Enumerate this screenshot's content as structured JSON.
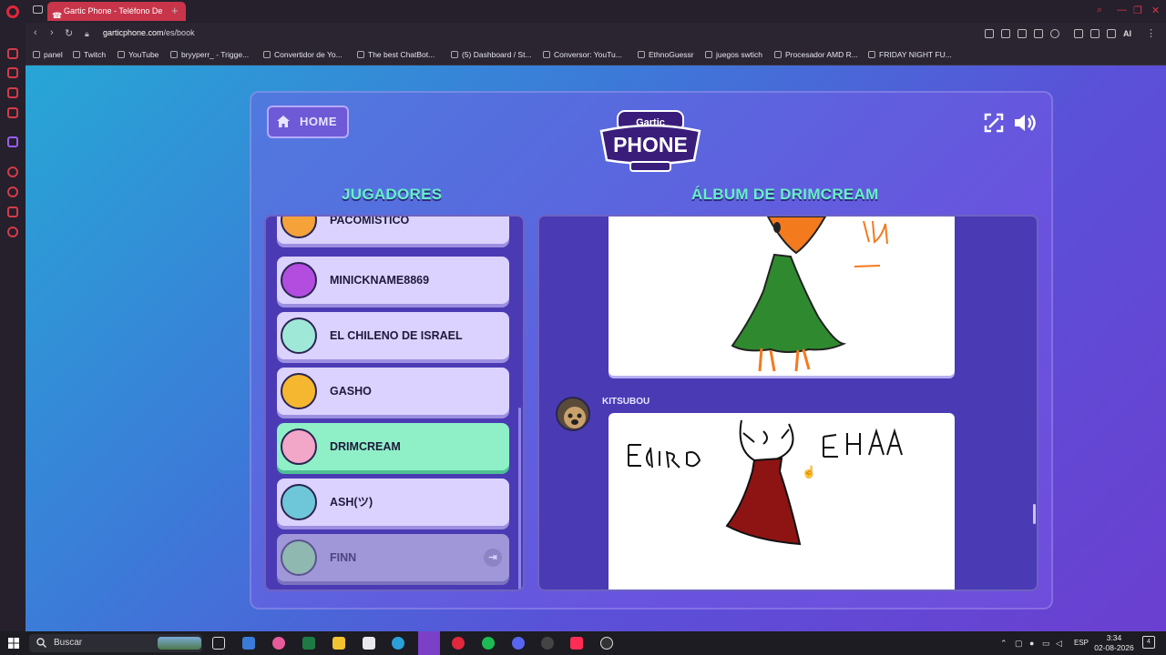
{
  "browser": {
    "tab_title": "Gartic Phone - Teléfono De",
    "new_tab": "+",
    "url_host": "garticphone.com",
    "url_path": "/es/book",
    "ai_label": "AI",
    "bookmarks": [
      {
        "label": "panel"
      },
      {
        "label": "Twitch"
      },
      {
        "label": "YouTube"
      },
      {
        "label": "bryyperr_ - Trigge..."
      },
      {
        "label": "Convertidor de Yo..."
      },
      {
        "label": "The best ChatBot..."
      },
      {
        "label": "(5) Dashboard / St..."
      },
      {
        "label": "Conversor: YouTu..."
      },
      {
        "label": "EthnoGuessr"
      },
      {
        "label": "juegos swtich"
      },
      {
        "label": "Procesador AMD R..."
      },
      {
        "label": "FRIDAY NIGHT FU..."
      }
    ]
  },
  "game": {
    "home_label": "HOME",
    "logo_top": "Gartic",
    "logo_bottom": "PHONE",
    "players_heading": "JUGADORES",
    "album_heading": "ÁLBUM DE DRIMCREAM",
    "players": [
      {
        "name": "PACOMISTICO",
        "state": "normal"
      },
      {
        "name": "MINICKNAME8869",
        "state": "normal"
      },
      {
        "name": "EL CHILENO DE ISRAEL",
        "state": "normal"
      },
      {
        "name": "GASHO",
        "state": "normal"
      },
      {
        "name": "DRIMCREAM",
        "state": "active"
      },
      {
        "name": "ASH(ツ)",
        "state": "normal"
      },
      {
        "name": "FINN",
        "state": "disconnected"
      }
    ],
    "album": {
      "author": "KITSUBOU"
    },
    "colors": {
      "heading": "#66f0c6",
      "active_player": "#8ff0c8",
      "player": "#dcd2ff"
    }
  },
  "taskbar": {
    "search_placeholder": "Buscar",
    "language": "ESP",
    "time": "3:34",
    "date": "02-08-2026",
    "notifications": "4"
  }
}
